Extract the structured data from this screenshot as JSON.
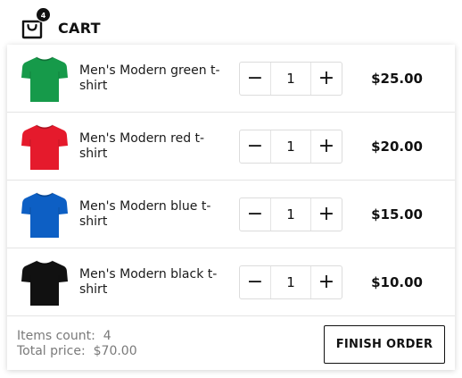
{
  "header": {
    "title": "CART",
    "badge_count": "4",
    "icon": "shopping-bag-icon"
  },
  "items": [
    {
      "name": "Men's Modern green t-shirt",
      "quantity": "1",
      "price": "$25.00",
      "color": "#169a4a",
      "icon": "tshirt-icon"
    },
    {
      "name": "Men's Modern red t-shirt",
      "quantity": "1",
      "price": "$20.00",
      "color": "#e51a2c",
      "icon": "tshirt-icon"
    },
    {
      "name": "Men's Modern blue t-shirt",
      "quantity": "1",
      "price": "$15.00",
      "color": "#0d5fc4",
      "icon": "tshirt-icon"
    },
    {
      "name": "Men's Modern black t-shirt",
      "quantity": "1",
      "price": "$10.00",
      "color": "#111111",
      "icon": "tshirt-icon"
    }
  ],
  "stepper": {
    "decrement_label": "−",
    "increment_label": "+"
  },
  "footer": {
    "items_count_label": "Items count:",
    "items_count_value": "4",
    "total_price_label": "Total price:",
    "total_price_value": "$70.00",
    "finish_label": "FINISH ORDER"
  }
}
